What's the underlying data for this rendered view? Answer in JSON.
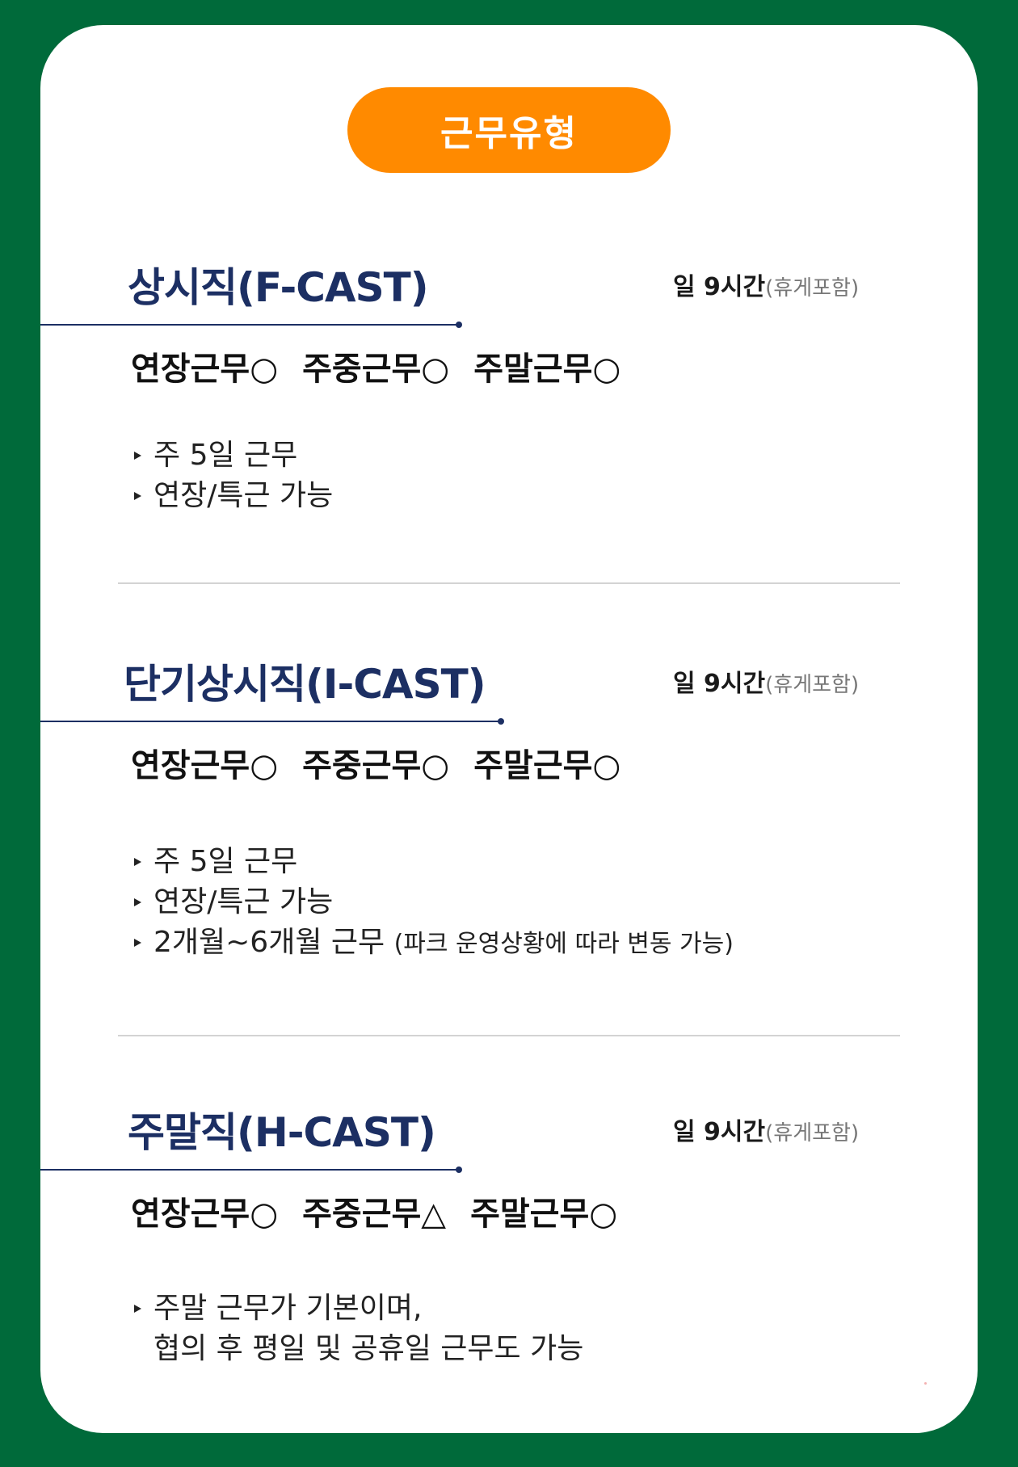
{
  "header": {
    "label": "근무유형"
  },
  "sections": [
    {
      "title": "상시직(F-CAST)",
      "hours": "일 9시간",
      "hours_note": "(휴게포함)",
      "options": [
        "연장근무○",
        "주중근무○",
        "주말근무○"
      ],
      "bullets": [
        "주 5일 근무",
        "연장/특근 가능"
      ]
    },
    {
      "title": "단기상시직(I-CAST)",
      "hours": "일 9시간",
      "hours_note": "(휴게포함)",
      "options": [
        "연장근무○",
        "주중근무○",
        "주말근무○"
      ],
      "bullets": [
        "주 5일 근무",
        "연장/특근 가능",
        "2개월~6개월 근무"
      ],
      "bullet_note": "(파크 운영상황에 따라 변동 가능)"
    },
    {
      "title": "주말직(H-CAST)",
      "hours": "일 9시간",
      "hours_note": "(휴게포함)",
      "options": [
        "연장근무○",
        "주중근무△",
        "주말근무○"
      ],
      "bullets": [
        "주말 근무가 기본이며,"
      ],
      "bullet_continuation": "협의 후 평일 및 공휴일 근무도 가능"
    }
  ],
  "colors": {
    "background": "#006a3a",
    "card": "#ffffff",
    "accent": "#ff8a00",
    "title": "#1c2f63"
  }
}
